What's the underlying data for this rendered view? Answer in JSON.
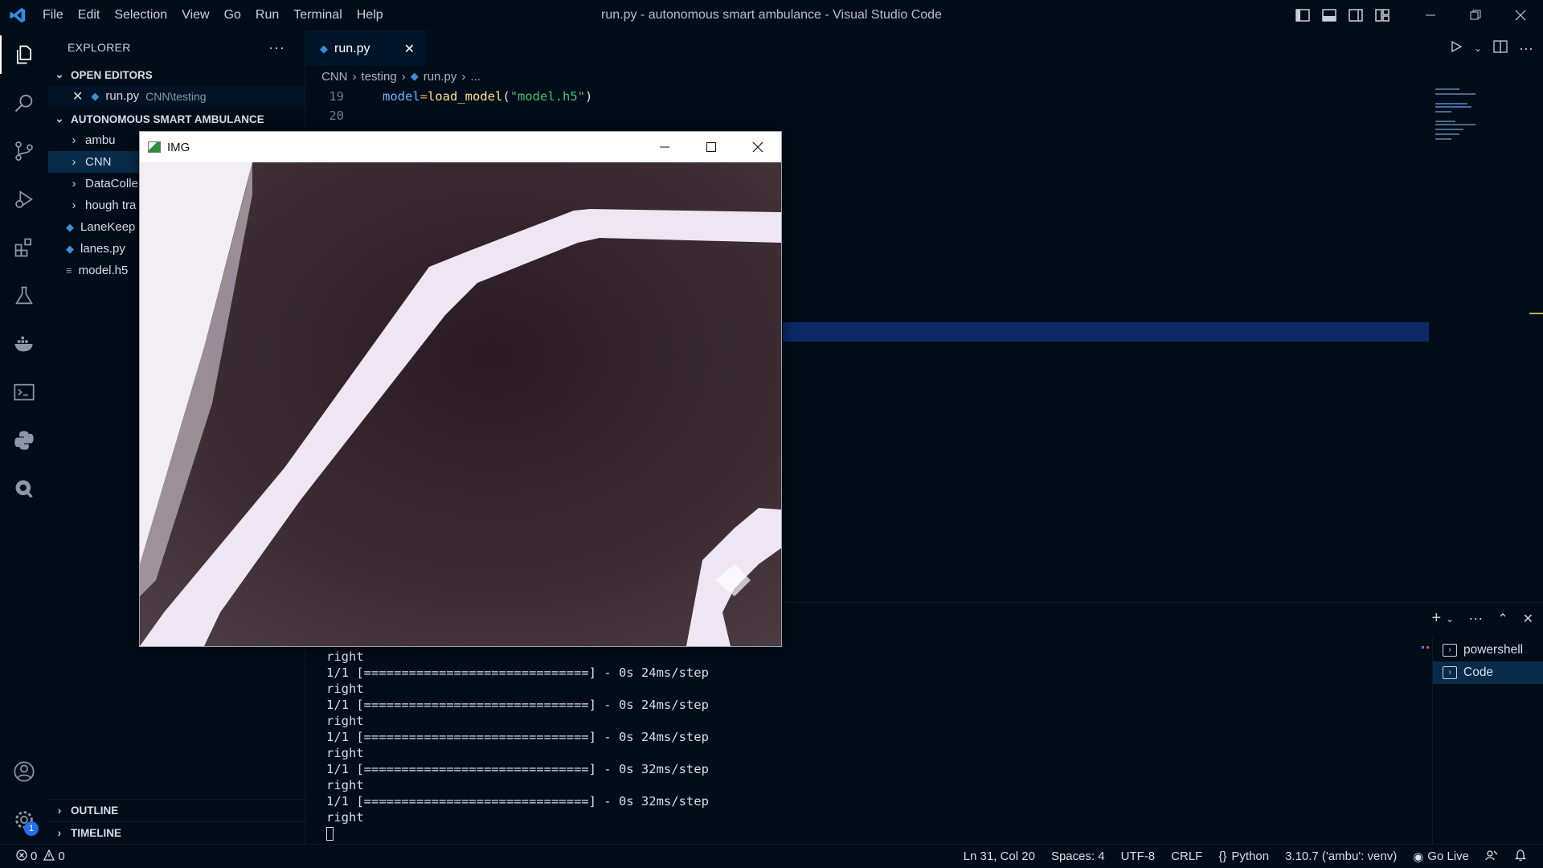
{
  "window": {
    "title": "run.py - autonomous smart ambulance - Visual Studio Code",
    "menu": [
      "File",
      "Edit",
      "Selection",
      "View",
      "Go",
      "Run",
      "Terminal",
      "Help"
    ]
  },
  "sidebar": {
    "header": "EXPLORER",
    "open_editors_label": "OPEN EDITORS",
    "open_editor": {
      "name": "run.py",
      "path": "CNN\\testing"
    },
    "project_label": "AUTONOMOUS SMART AMBULANCE",
    "tree": [
      {
        "label": "ambu",
        "type": "folder"
      },
      {
        "label": "CNN",
        "type": "folder"
      },
      {
        "label": "DataColle",
        "type": "folder"
      },
      {
        "label": "hough tra",
        "type": "folder"
      },
      {
        "label": "LaneKeep",
        "type": "python"
      },
      {
        "label": "lanes.py",
        "type": "python"
      },
      {
        "label": "model.h5",
        "type": "file"
      }
    ],
    "outline_label": "OUTLINE",
    "timeline_label": "TIMELINE"
  },
  "editor": {
    "tab_label": "run.py",
    "breadcrumb": [
      "CNN",
      "testing",
      "run.py",
      "..."
    ],
    "lines": [
      {
        "number": "19",
        "var": "model",
        "op": "=",
        "fn": "load_model",
        "open": "(",
        "str": "\"model.h5\"",
        "close": ")"
      },
      {
        "number": "20"
      }
    ]
  },
  "img_window": {
    "title": "IMG"
  },
  "terminal": {
    "output": [
      "right",
      "1/1 [==============================] - 0s 24ms/step",
      "right",
      "1/1 [==============================] - 0s 24ms/step",
      "right",
      "1/1 [==============================] - 0s 24ms/step",
      "right",
      "1/1 [==============================] - 0s 32ms/step",
      "right",
      "1/1 [==============================] - 0s 32ms/step",
      "right"
    ],
    "sessions": [
      "powershell",
      "Code"
    ]
  },
  "statusbar": {
    "errors": "0",
    "warnings": "0",
    "position": "Ln 31, Col 20",
    "spaces": "Spaces: 4",
    "encoding": "UTF-8",
    "eol": "CRLF",
    "language": "Python",
    "interpreter": "3.10.7 ('ambu': venv)",
    "go_live": "Go Live"
  },
  "accounts_badge": "1",
  "colors": {
    "background": "#000c18",
    "accent": "#1f6feb",
    "highlight": "#0b2a66"
  }
}
